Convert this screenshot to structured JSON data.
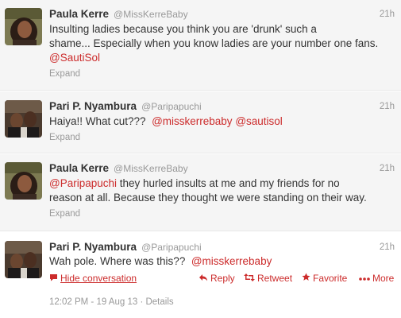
{
  "tweets": [
    {
      "name": "Paula Kerre",
      "handle": "@MissKerreBaby",
      "time": "21h",
      "lines": [
        "Insulting ladies because you think you are 'drunk' such a",
        "shame... Especially when you know ladies are your number one fans."
      ],
      "mention_line": "@SautiSol",
      "expand": "Expand"
    },
    {
      "name": "Pari P. Nyambura",
      "handle": "@Paripapuchi",
      "time": "21h",
      "text": "Haiya!! What cut???",
      "mentions": [
        "@misskerrebaby",
        "@sautisol"
      ],
      "expand": "Expand"
    },
    {
      "name": "Paula Kerre",
      "handle": "@MissKerreBaby",
      "time": "21h",
      "mention": "@Paripapuchi",
      "line1_rest": " they hurled insults at me and my friends for no",
      "line2": "reason at all. Because they thought we were standing on their way.",
      "expand": "Expand"
    },
    {
      "name": "Pari P. Nyambura",
      "handle": "@Paripapuchi",
      "time": "21h",
      "text": "Wah pole. Where was this??",
      "mention": "@misskerrebaby",
      "actions": {
        "hide": "Hide conversation",
        "reply": "Reply",
        "retweet": "Retweet",
        "favorite": "Favorite",
        "more": "More"
      },
      "meta": {
        "timestamp": "12:02 PM - 19 Aug 13",
        "sep": " · ",
        "details": "Details"
      }
    }
  ],
  "colors": {
    "link": "#cc2b2b",
    "muted": "#999999",
    "collapsed_bg": "#f5f5f5"
  }
}
